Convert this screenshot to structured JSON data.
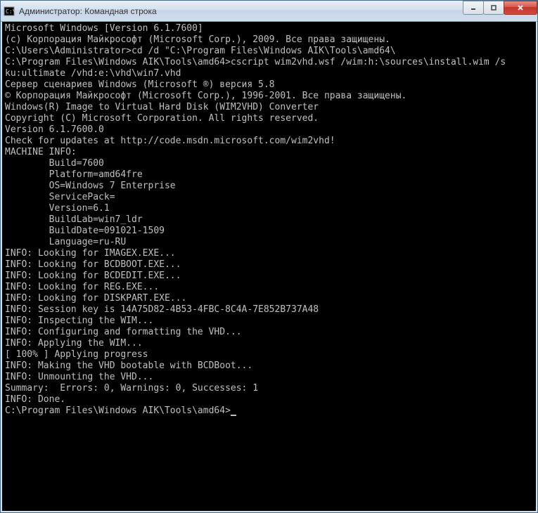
{
  "window": {
    "title": "Администратор: Командная строка"
  },
  "terminal": {
    "lines": [
      "Microsoft Windows [Version 6.1.7600]",
      "(c) Корпорация Майкрософт (Microsoft Corp.), 2009. Все права защищены.",
      "",
      "C:\\Users\\Administrator>cd /d \"C:\\Program Files\\Windows AIK\\Tools\\amd64\\",
      "",
      "C:\\Program Files\\Windows AIK\\Tools\\amd64>cscript wim2vhd.wsf /wim:h:\\sources\\install.wim /s",
      "ku:ultimate /vhd:e:\\vhd\\win7.vhd",
      "Сервер сценариев Windows (Microsoft ®) версия 5.8",
      "© Корпорация Майкрософт (Microsoft Corp.), 1996-2001. Все права защищены.",
      "",
      "Windows(R) Image to Virtual Hard Disk (WIM2VHD) Converter",
      "Copyright (C) Microsoft Corporation. All rights reserved.",
      "Version 6.1.7600.0",
      "",
      "Check for updates at http://code.msdn.microsoft.com/wim2vhd!",
      "",
      "MACHINE INFO:",
      "        Build=7600",
      "        Platform=amd64fre",
      "        OS=Windows 7 Enterprise",
      "        ServicePack=",
      "        Version=6.1",
      "        BuildLab=win7_ldr",
      "        BuildDate=091021-1509",
      "        Language=ru-RU",
      "",
      "INFO: Looking for IMAGEX.EXE...",
      "INFO: Looking for BCDBOOT.EXE...",
      "INFO: Looking for BCDEDIT.EXE...",
      "INFO: Looking for REG.EXE...",
      "INFO: Looking for DISKPART.EXE...",
      "INFO: Session key is 14A75D82-4B53-4FBC-8C4A-7E852B737A48",
      "INFO: Inspecting the WIM...",
      "INFO: Configuring and formatting the VHD...",
      "INFO: Applying the WIM...",
      "[ 100% ] Applying progress",
      "INFO: Making the VHD bootable with BCDBoot...",
      "INFO: Unmounting the VHD...",
      "Summary:  Errors: 0, Warnings: 0, Successes: 1",
      "INFO: Done.",
      "",
      "C:\\Program Files\\Windows AIK\\Tools\\amd64>"
    ]
  }
}
